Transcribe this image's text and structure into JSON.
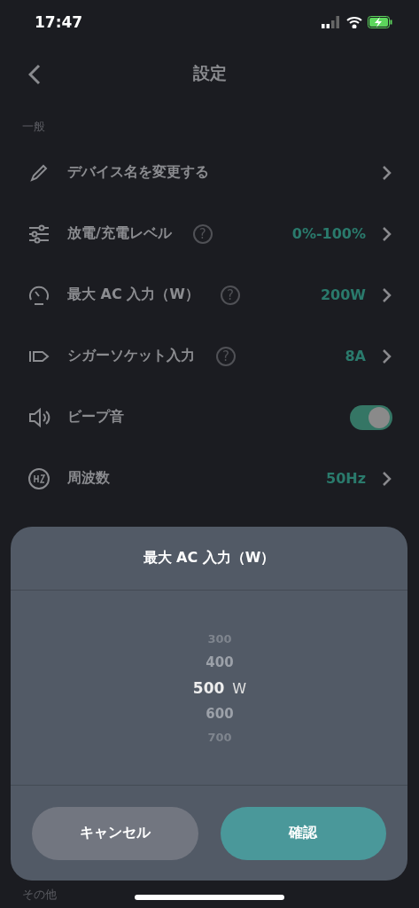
{
  "status_bar": {
    "time": "17:47",
    "charging": true
  },
  "nav": {
    "title": "設定"
  },
  "sections": [
    {
      "title": "一般",
      "items": [
        {
          "label": "デバイス名を変更する",
          "kind": "link"
        },
        {
          "label": "放電/充電レベル",
          "help": "?",
          "value": "0%-100%",
          "kind": "link"
        },
        {
          "label": "最大 AC 入力（W）",
          "help": "?",
          "value": "200W",
          "kind": "link"
        },
        {
          "label": "シガーソケット入力",
          "help": "?",
          "value": "8A",
          "kind": "link"
        },
        {
          "label": "ビープ音",
          "on": true,
          "kind": "toggle"
        },
        {
          "label": "周波数",
          "value": "50Hz",
          "kind": "link"
        }
      ]
    },
    {
      "title": "その他"
    }
  ],
  "sheet": {
    "title": "最大 AC 入力（W）",
    "unit": "W",
    "options": [
      {
        "label": "300",
        "selected": false
      },
      {
        "label": "400",
        "selected": false
      },
      {
        "label": "500",
        "selected": true
      },
      {
        "label": "600",
        "selected": false
      },
      {
        "label": "700",
        "selected": false
      }
    ],
    "buttons": [
      {
        "label": "キャンセル",
        "kind": "secondary"
      },
      {
        "label": "確認",
        "kind": "primary"
      }
    ]
  }
}
